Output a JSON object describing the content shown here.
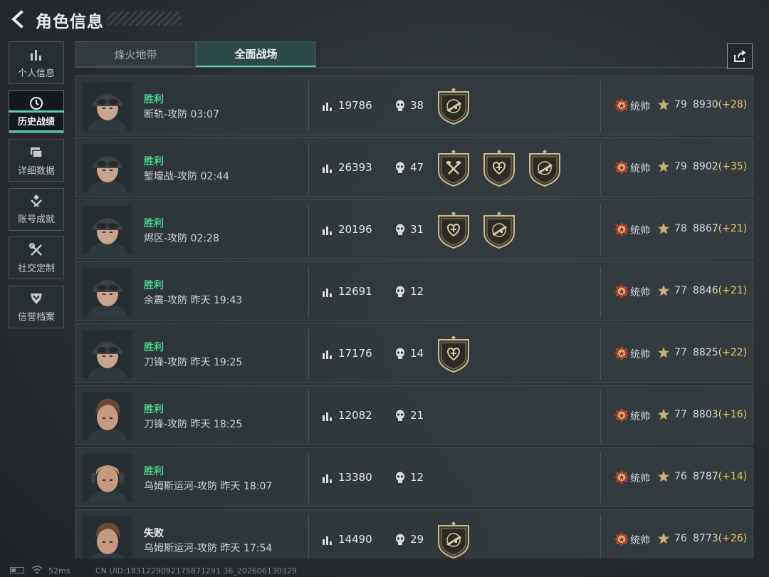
{
  "header": {
    "title": "角色信息"
  },
  "sidebar": {
    "items": [
      {
        "label": "个人信息",
        "icon": "bar-chart-icon",
        "active": false
      },
      {
        "label": "历史战绩",
        "icon": "history-clock-icon",
        "active": true
      },
      {
        "label": "详细数据",
        "icon": "folder-icon",
        "active": false
      },
      {
        "label": "账号成就",
        "icon": "achievement-icon",
        "active": false
      },
      {
        "label": "社交定制",
        "icon": "tools-icon",
        "active": false
      },
      {
        "label": "信誉档案",
        "icon": "shield-rank-icon",
        "active": false
      }
    ]
  },
  "tabs": [
    {
      "label": "烽火地带",
      "active": false
    },
    {
      "label": "全面战场",
      "active": true
    }
  ],
  "colors": {
    "win": "#47d58e",
    "accent": "#57c9a3",
    "delta": "#e8c766"
  },
  "matches": [
    {
      "result": "胜利",
      "win": true,
      "mode": "断轨-攻防 03:07",
      "score": "19786",
      "kills": "38",
      "badges": [
        "rifle-badge-icon"
      ],
      "rank": "统帅",
      "level": "79",
      "points": "8930",
      "delta": "(+28)",
      "avatar": "female-soldier"
    },
    {
      "result": "胜利",
      "win": true,
      "mode": "堑壕战-攻防 02:44",
      "score": "26393",
      "kills": "47",
      "badges": [
        "axe-badge-icon",
        "medic-badge-icon",
        "rifle-badge-icon"
      ],
      "rank": "统帅",
      "level": "79",
      "points": "8902",
      "delta": "(+35)",
      "avatar": "female-soldier"
    },
    {
      "result": "胜利",
      "win": true,
      "mode": "烬区-攻防 02:28",
      "score": "20196",
      "kills": "31",
      "badges": [
        "medic-badge-icon",
        "rifle-badge-icon"
      ],
      "rank": "统帅",
      "level": "78",
      "points": "8867",
      "delta": "(+21)",
      "avatar": "female-soldier"
    },
    {
      "result": "胜利",
      "win": true,
      "mode": "余震-攻防 昨天 19:43",
      "score": "12691",
      "kills": "12",
      "badges": [],
      "rank": "统帅",
      "level": "77",
      "points": "8846",
      "delta": "(+21)",
      "avatar": "female-soldier"
    },
    {
      "result": "胜利",
      "win": true,
      "mode": "刀锋-攻防 昨天 19:25",
      "score": "17176",
      "kills": "14",
      "badges": [
        "medic-badge-icon"
      ],
      "rank": "统帅",
      "level": "77",
      "points": "8825",
      "delta": "(+22)",
      "avatar": "female-soldier"
    },
    {
      "result": "胜利",
      "win": true,
      "mode": "刀锋-攻防 昨天 18:25",
      "score": "12082",
      "kills": "21",
      "badges": [],
      "rank": "统帅",
      "level": "77",
      "points": "8803",
      "delta": "(+16)",
      "avatar": "male-soldier"
    },
    {
      "result": "胜利",
      "win": true,
      "mode": "乌姆斯运河-攻防 昨天 18:07",
      "score": "13380",
      "kills": "12",
      "badges": [],
      "rank": "统帅",
      "level": "76",
      "points": "8787",
      "delta": "(+14)",
      "avatar": "blond-soldier"
    },
    {
      "result": "失败",
      "win": false,
      "mode": "乌姆斯运河-攻防 昨天 17:54",
      "score": "14490",
      "kills": "29",
      "badges": [
        "rifle-badge-icon"
      ],
      "rank": "统帅",
      "level": "76",
      "points": "8773",
      "delta": "(+26)",
      "avatar": "male-soldier"
    }
  ],
  "status": {
    "ping": "52ms",
    "uid": "CN UID:1831229092175871291 36_202606130329"
  }
}
